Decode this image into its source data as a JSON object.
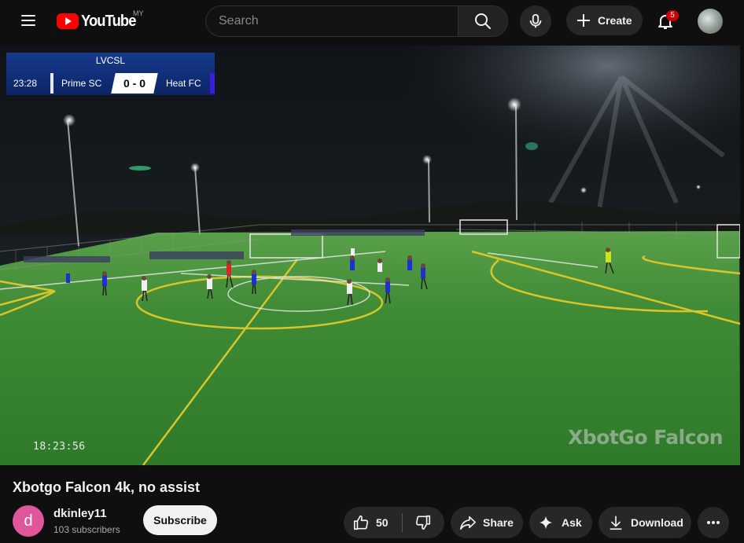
{
  "header": {
    "logo_text": "YouTube",
    "region_code": "MY",
    "search_placeholder": "Search",
    "create_label": "Create",
    "notification_count": "5"
  },
  "video": {
    "scoreboard": {
      "league": "LVCSL",
      "clock": "23:28",
      "home_team": "Prime SC",
      "score": "0 - 0",
      "away_team": "Heat FC"
    },
    "timestamp": "18:23:56",
    "watermark": "XbotGo Falcon"
  },
  "info": {
    "title": "Xbotgo Falcon 4k, no assist",
    "channel_initial": "d",
    "channel_name": "dkinley11",
    "subscribers": "103 subscribers",
    "subscribe_label": "Subscribe",
    "like_count": "50",
    "share_label": "Share",
    "ask_label": "Ask",
    "download_label": "Download"
  },
  "colors": {
    "brand_red": "#ff0000",
    "avatar_pink": "#e0569a",
    "pitch_green": "#3f8a35"
  }
}
